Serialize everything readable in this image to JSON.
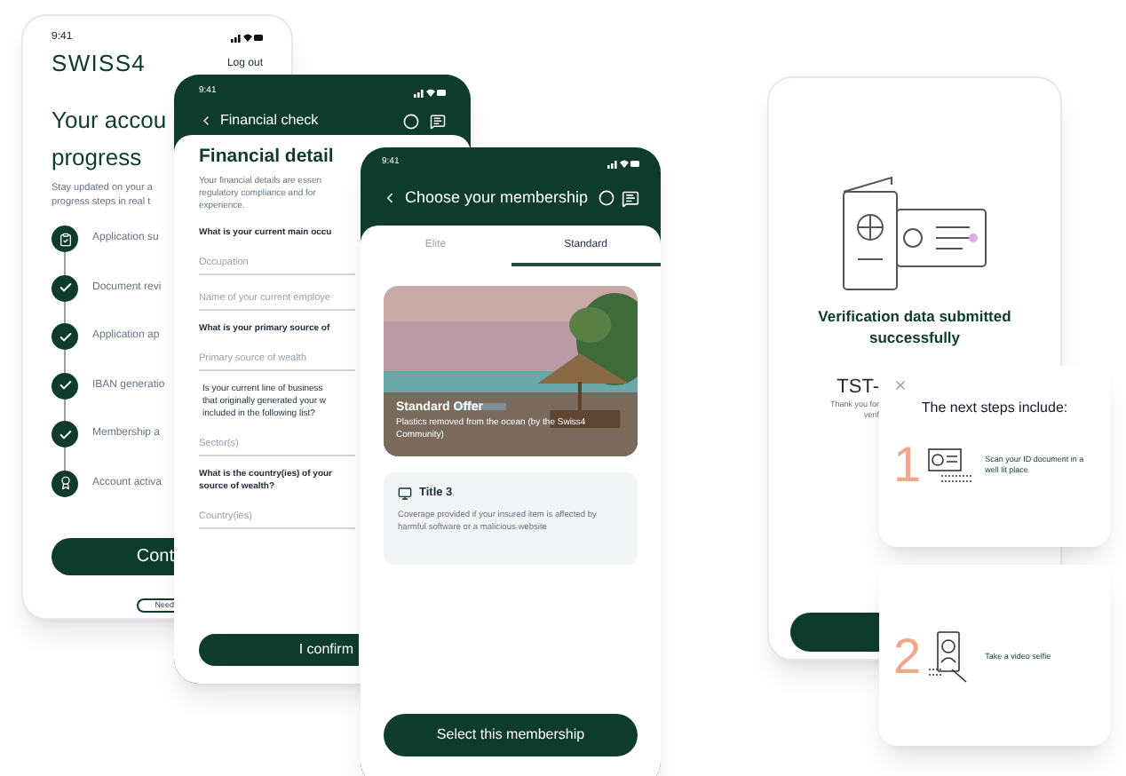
{
  "account_screen": {
    "time": "9:41",
    "logo": "SWISS4",
    "logout": "Log out",
    "title": "Your accou\nprogress",
    "intro": "Stay updated on your a\nprogress steps in real t",
    "steps": [
      {
        "label": "Application su",
        "kind": "submitted"
      },
      {
        "label": "Document revi",
        "kind": "done"
      },
      {
        "label": "Application ap",
        "kind": "done"
      },
      {
        "label": "IBAN generatio",
        "kind": "done"
      },
      {
        "label": "Membership a",
        "kind": "done"
      },
      {
        "label": "Account activa",
        "kind": "activation"
      }
    ],
    "continue_button": "Cont",
    "help_button": "Need"
  },
  "financial_screen": {
    "time": "9:41",
    "header": "Financial check",
    "title": "Financial detail",
    "intro": "Your financial details are essen\nregulatory compliance and for\nexperience.",
    "questions": [
      {
        "kind": "label",
        "text": "What is your current main occu"
      },
      {
        "kind": "field",
        "placeholder": "Occupation"
      },
      {
        "kind": "field",
        "placeholder": "Name of your current employe"
      },
      {
        "kind": "label",
        "text": "What is your primary source of"
      },
      {
        "kind": "field",
        "placeholder": "Primary source of wealth"
      },
      {
        "kind": "note",
        "text": "Is your current line of business\nthat originally generated your w\nincluded in the following list?"
      },
      {
        "kind": "field",
        "placeholder": "Sector(s)"
      },
      {
        "kind": "label",
        "text": "What is the country(ies) of your\nsource of wealth?"
      },
      {
        "kind": "field",
        "placeholder": "Country(ies)"
      }
    ],
    "confirm_button": "I confirm"
  },
  "membership_screen": {
    "time": "9:41",
    "header": "Choose your membership",
    "tabs": [
      {
        "label": "Elite",
        "selected": false
      },
      {
        "label": "Standard",
        "selected": true
      }
    ],
    "offer": {
      "title": "Standard Offer",
      "text": "Plastics removed from the ocean (by the Swiss4 Community)"
    },
    "benefit": {
      "title": "Title 3",
      "text": "Coverage provided if your insured item is affected by harmful software or a malicious website"
    },
    "select_button": "Select this membership"
  },
  "verification_screen": {
    "title": "Verification data submitted successfully",
    "reference": "TST-",
    "note": "Thank you for\nverif"
  },
  "next_steps": {
    "heading": "The next steps include:",
    "steps": [
      {
        "number": "1",
        "text": "Scan your ID document in a well lit place",
        "kind": "document"
      },
      {
        "number": "2",
        "text": "Take a video selfie",
        "kind": "selfie"
      }
    ]
  }
}
